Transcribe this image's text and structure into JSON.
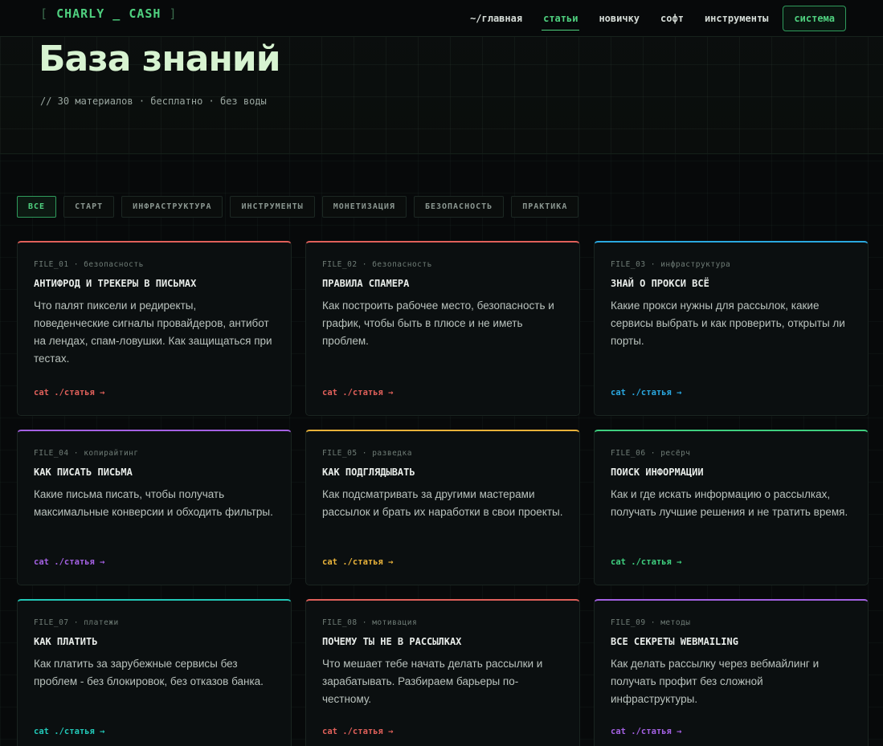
{
  "nav": {
    "logo_open": "[",
    "logo_text": "CHARLY _ CASH",
    "logo_close": "]",
    "links": [
      {
        "label": "~/главная"
      },
      {
        "label": "статьи"
      },
      {
        "label": "новичку"
      },
      {
        "label": "софт"
      },
      {
        "label": "инструменты"
      }
    ],
    "system_button": "система"
  },
  "hero": {
    "title": "База знаний",
    "subtitle": "// 30 материалов · бесплатно · без воды"
  },
  "filters": [
    {
      "label": "ВСЕ"
    },
    {
      "label": "СТАРТ"
    },
    {
      "label": "ИНФРАСТРУКТУРА"
    },
    {
      "label": "ИНСТРУМЕНТЫ"
    },
    {
      "label": "МОНЕТИЗАЦИЯ"
    },
    {
      "label": "БЕЗОПАСНОСТЬ"
    },
    {
      "label": "ПРАКТИКА"
    }
  ],
  "colors": {
    "brand": "#4fd07f",
    "red": "#e0605a",
    "blue": "#2aa8e0",
    "purple": "#a461e3",
    "amber": "#e8b23a",
    "green": "#3fcf7f",
    "teal": "#22c8b8"
  },
  "cards": [
    {
      "meta": "FILE_01 · безопасность",
      "title": "АНТИФРОД И ТРЕКЕРЫ В ПИСЬМАХ",
      "desc": "Что палят пиксели и редиректы, поведенческие сигналы провайдеров, антибот на лендах, спам-ловушки. Как защищаться при тестах.",
      "link": "cat ./статья →"
    },
    {
      "meta": "FILE_02 · безопасность",
      "title": "ПРАВИЛА СПАМЕРА",
      "desc": "Как построить рабочее место, безопасность и график, чтобы быть в плюсе и не иметь проблем.",
      "link": "cat ./статья →"
    },
    {
      "meta": "FILE_03 · инфраструктура",
      "title": "ЗНАЙ О ПРОКСИ ВСЁ",
      "desc": "Какие прокси нужны для рассылок, какие сервисы выбрать и как проверить, открыты ли порты.",
      "link": "cat ./статья →"
    },
    {
      "meta": "FILE_04 · копирайтинг",
      "title": "КАК ПИСАТЬ ПИСЬМА",
      "desc": "Какие письма писать, чтобы получать максимальные конверсии и обходить фильтры.",
      "link": "cat ./статья →"
    },
    {
      "meta": "FILE_05 · разведка",
      "title": "КАК ПОДГЛЯДЫВАТЬ",
      "desc": "Как подсматривать за другими мастерами рассылок и брать их наработки в свои проекты.",
      "link": "cat ./статья →"
    },
    {
      "meta": "FILE_06 · ресёрч",
      "title": "ПОИСК ИНФОРМАЦИИ",
      "desc": "Как и где искать информацию о рассылках, получать лучшие решения и не тратить время.",
      "link": "cat ./статья →"
    },
    {
      "meta": "FILE_07 · платежи",
      "title": "КАК ПЛАТИТЬ",
      "desc": "Как платить за зарубежные сервисы без проблем - без блокировок, без отказов банка.",
      "link": "cat ./статья →"
    },
    {
      "meta": "FILE_08 · мотивация",
      "title": "ПОЧЕМУ ТЫ НЕ В РАССЫЛКАХ",
      "desc": "Что мешает тебе начать делать рассылки и зарабатывать. Разбираем барьеры по-честному.",
      "link": "cat ./статья →"
    },
    {
      "meta": "FILE_09 · методы",
      "title": "ВСЕ СЕКРЕТЫ WEBMAILING",
      "desc": "Как делать рассылку через вебмайлинг и получать профит без сложной инфраструктуры.",
      "link": "cat ./статья →"
    }
  ]
}
